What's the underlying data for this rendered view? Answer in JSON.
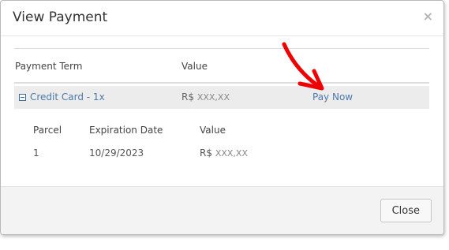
{
  "modal": {
    "title": "View Payment"
  },
  "table": {
    "headers": {
      "term": "Payment Term",
      "value": "Value"
    },
    "row": {
      "term": "Credit Card - 1x",
      "value": "R$",
      "amount": "XXX,XX",
      "action": "Pay Now"
    }
  },
  "subtable": {
    "headers": {
      "parcel": "Parcel",
      "expiration": "Expiration Date",
      "value": "Value"
    },
    "rows": [
      {
        "parcel": "1",
        "expiration": "10/29/2023",
        "value": "R$",
        "amount": "XXX,XX"
      }
    ]
  },
  "footer": {
    "close_label": "Close"
  },
  "colors": {
    "link": "#4d79a8",
    "annotation_arrow": "#ee0000"
  }
}
